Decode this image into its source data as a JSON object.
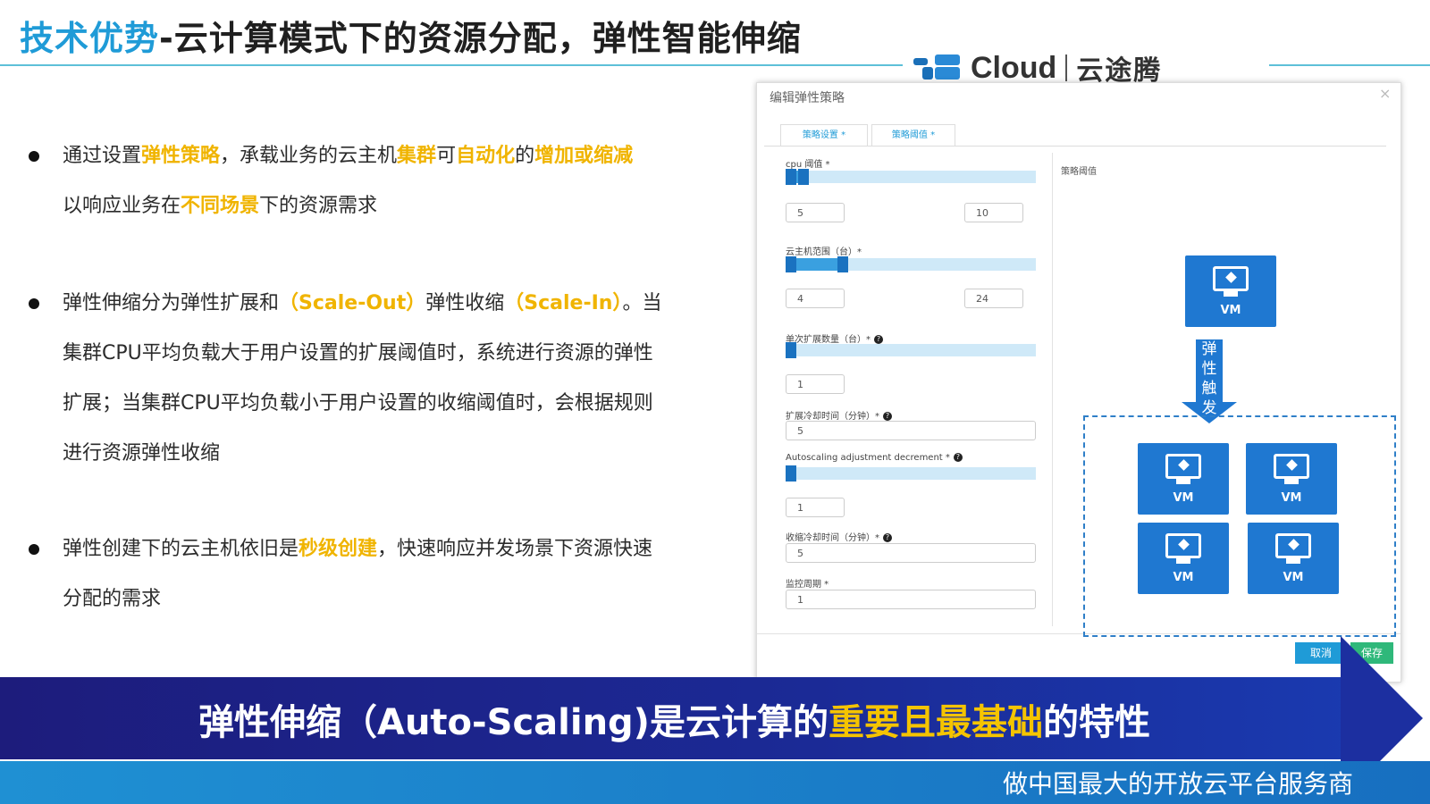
{
  "header": {
    "title_highlight": "技术优势",
    "title_rest": "-云计算模式下的资源分配，弹性智能伸缩",
    "logo_brand": "Cloud",
    "logo_cn": "云途腾"
  },
  "bullets": [
    {
      "segments": [
        "通过设置",
        "弹性策略",
        "，承载业务的云主机",
        "集群",
        "可",
        "自动化",
        "的",
        "增加或缩减",
        "以响应业务在",
        "不同场景",
        "下的资源需求"
      ]
    },
    {
      "segments": [
        "弹性伸缩分为弹性扩展和",
        "（Scale-Out）",
        "弹性收缩",
        "（Scale-In）",
        "。当集群CPU平均负载大于用户设置的扩展阈值时，系统进行资源的弹性扩展；当集群CPU平均负载小于用户设置的收缩阈值时，会根据规则进行资源弹性收缩"
      ]
    },
    {
      "segments": [
        "弹性创建下的云主机依旧是",
        "秒级创建",
        "，快速响应并发场景下资源快速分配的需求"
      ]
    }
  ],
  "panel": {
    "title": "编辑弹性策略",
    "close": "×",
    "tabs": [
      "策略设置 *",
      "策略阈值 *"
    ],
    "side_label": "策略阈值",
    "fields": [
      {
        "label": "cpu 阈值 *",
        "min": "5",
        "max": "10"
      },
      {
        "label": "云主机范围（台）*",
        "min": "4",
        "max": "24"
      },
      {
        "label": "单次扩展数量（台）*",
        "value": "1"
      },
      {
        "label": "扩展冷却时间（分钟）*",
        "value": "5"
      },
      {
        "label": "Autoscaling adjustment decrement *",
        "value": "1"
      },
      {
        "label": "收缩冷却时间（分钟）*",
        "value": "5"
      },
      {
        "label": "监控周期 *",
        "value": "1"
      }
    ],
    "cancel": "取消",
    "save": "保存"
  },
  "diagram": {
    "vm_label": "VM",
    "trigger": "弹性触发"
  },
  "banner": {
    "part1": "弹性伸缩（Auto-Scaling)是云计算的",
    "highlight": "重要且最基础",
    "part2": "的特性"
  },
  "slogan": "做中国最大的开放云平台服务商",
  "colors": {
    "accent": "#1f9bd7",
    "highlight": "#f0b400",
    "banner": "#1d1c7c",
    "vm": "#1f78d1"
  }
}
